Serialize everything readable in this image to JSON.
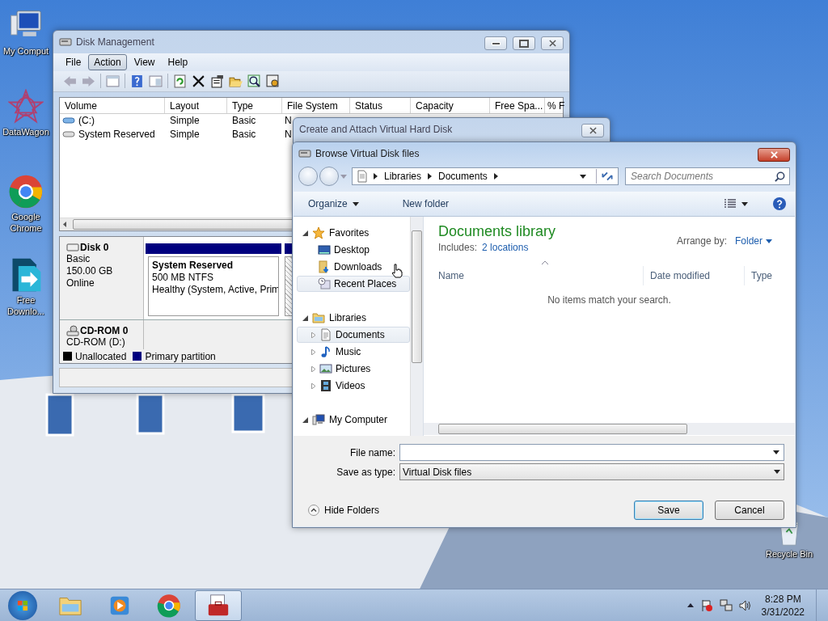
{
  "desktop_icons": [
    {
      "label": "My Comput",
      "kind": "computer"
    },
    {
      "label": "DataWagon",
      "kind": "datawagon"
    },
    {
      "label": "Google Chrome",
      "kind": "chrome"
    },
    {
      "label": "Free Downlo...",
      "kind": "download"
    }
  ],
  "recycle_bin": {
    "label": "Recycle Bin"
  },
  "disk_management": {
    "title": "Disk Management",
    "menu": [
      {
        "label": "File",
        "selected": false
      },
      {
        "label": "Action",
        "selected": true
      },
      {
        "label": "View",
        "selected": false
      },
      {
        "label": "Help",
        "selected": false
      }
    ],
    "table": {
      "columns": [
        "Volume",
        "Layout",
        "Type",
        "File System",
        "Status",
        "Capacity",
        "Free Spa...",
        "% F"
      ],
      "rows": [
        {
          "volume": "(C:)",
          "kind": "system",
          "layout": "Simple",
          "type": "Basic",
          "file_system": "N"
        },
        {
          "volume": "System Reserved",
          "kind": "reserved",
          "layout": "Simple",
          "type": "Basic",
          "file_system": "N"
        }
      ]
    },
    "disks": [
      {
        "name": "Disk 0",
        "kind": "hdd",
        "lines": [
          "Basic",
          "150.00 GB",
          "Online"
        ],
        "partition": {
          "name": "System Reserved",
          "lines": [
            "500 MB NTFS",
            "Healthy (System, Active, Prim"
          ]
        }
      },
      {
        "name": "CD-ROM 0",
        "kind": "cdrom",
        "lines": [
          "CD-ROM (D:)"
        ]
      }
    ],
    "legend": [
      {
        "label": "Unallocated",
        "color": "#000000"
      },
      {
        "label": "Primary partition",
        "color": "#00007f"
      }
    ]
  },
  "attach_window": {
    "title": "Create and Attach Virtual Hard Disk"
  },
  "browse_dialog": {
    "title": "Browse Virtual Disk files",
    "breadcrumb": [
      "Libraries",
      "Documents"
    ],
    "search": {
      "placeholder": "Search Documents"
    },
    "toolbar": {
      "organize": "Organize",
      "new_folder": "New folder"
    },
    "nav": [
      {
        "label": "Favorites",
        "kind": "star",
        "expanded": true,
        "children": [
          {
            "label": "Desktop",
            "kind": "desktop",
            "selected": false
          },
          {
            "label": "Downloads",
            "kind": "downloads",
            "selected": false
          },
          {
            "label": "Recent Places",
            "kind": "recent",
            "selected": true
          }
        ]
      },
      {
        "label": "Libraries",
        "kind": "libraries",
        "expanded": true,
        "children": [
          {
            "label": "Documents",
            "kind": "document",
            "selected": true,
            "expanded": false
          },
          {
            "label": "Music",
            "kind": "music",
            "selected": false,
            "expanded": false
          },
          {
            "label": "Pictures",
            "kind": "pictures",
            "selected": false,
            "expanded": false
          },
          {
            "label": "Videos",
            "kind": "videos",
            "selected": false,
            "expanded": false
          }
        ]
      },
      {
        "label": "My Computer",
        "kind": "computer",
        "expanded": true
      }
    ],
    "library_title": "Documents library",
    "includes_label": "Includes:",
    "includes_link": "2 locations",
    "arrange_label": "Arrange by:",
    "arrange_value": "Folder",
    "columns": [
      "Name",
      "Date modified",
      "Type"
    ],
    "empty_message": "No items match your search.",
    "file_name": {
      "label": "File name:"
    },
    "save_as_type": {
      "label": "Save as type:",
      "value": "Virtual Disk files"
    },
    "hide_folders": "Hide Folders",
    "buttons": [
      {
        "label": "Save",
        "kind": "default"
      },
      {
        "label": "Cancel",
        "kind": "normal"
      }
    ]
  },
  "taskbar": {
    "apps": [
      {
        "kind": "explorer",
        "selected": false
      },
      {
        "kind": "media",
        "selected": false
      },
      {
        "kind": "chrome",
        "selected": false
      },
      {
        "kind": "toolbox",
        "selected": true
      }
    ],
    "clock": {
      "time": "8:28 PM",
      "date": "3/31/2022"
    }
  }
}
